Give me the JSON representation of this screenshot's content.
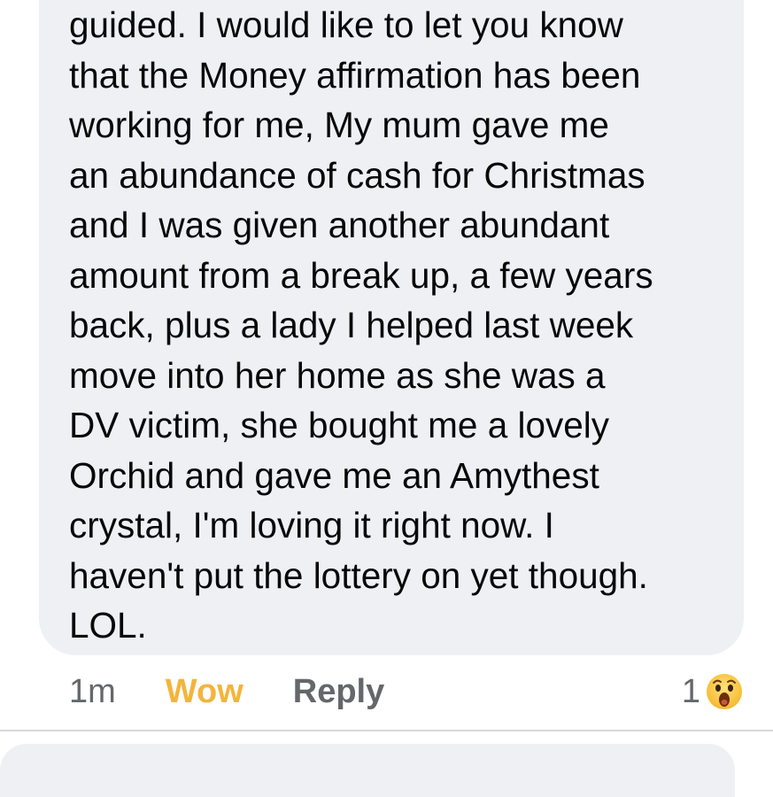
{
  "comment": {
    "lines": [
      "guided. I would like to let you know",
      "that the Money affirmation has been",
      "working for me, My mum gave me",
      "an abundance of cash for Christmas",
      "and I was given another abundant",
      "amount from a break up, a few years",
      "back, plus a lady I helped last week",
      "move into her home as she was a",
      "DV victim, she bought me a lovely",
      "Orchid and gave me an Amythest",
      "crystal, I'm loving it right now. I",
      "haven't put the lottery on yet though.",
      "LOL."
    ],
    "timestamp": "1m",
    "reaction_label": "Wow",
    "reply_label": "Reply",
    "reaction_count": "1",
    "reaction_icon": "wow-emoji-icon",
    "colors": {
      "bubble": "#eff0f4",
      "text": "#080809",
      "meta": "#65676b",
      "wow": "#f4b43d"
    }
  }
}
